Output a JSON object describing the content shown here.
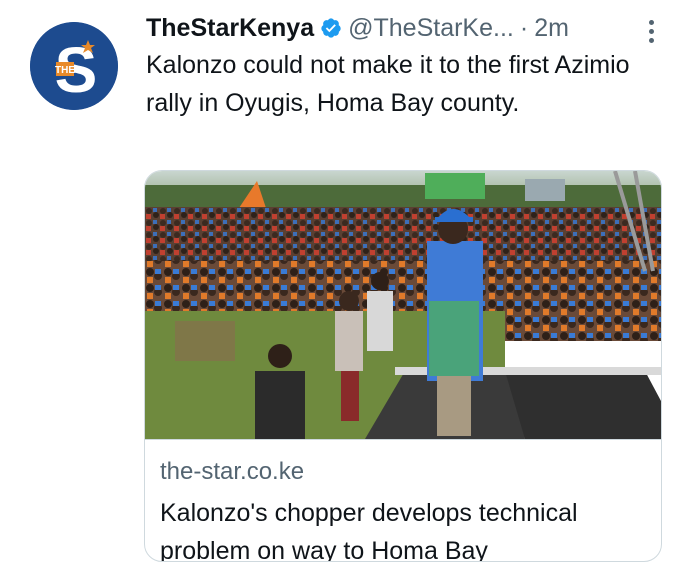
{
  "tweet": {
    "display_name": "TheStarKenya",
    "handle": "@TheStarKe...",
    "separator": "·",
    "time": "2m",
    "text": "Kalonzo could not make it to the first Azimio rally in Oyugis, Homa Bay county.",
    "avatar_icon": "the-star-logo-icon",
    "verified_icon": "verified-badge-icon",
    "more_icon": "more-options-icon"
  },
  "card": {
    "domain": "the-star.co.ke",
    "title": "Kalonzo's chopper develops technical problem on way to Homa Bay",
    "image_description_icon": "rally-photo"
  },
  "colors": {
    "text_primary": "#0f1419",
    "text_secondary": "#536471",
    "verified_blue": "#1d9bf0",
    "avatar_blue": "#1d4b8f",
    "border": "#cfd9de"
  }
}
